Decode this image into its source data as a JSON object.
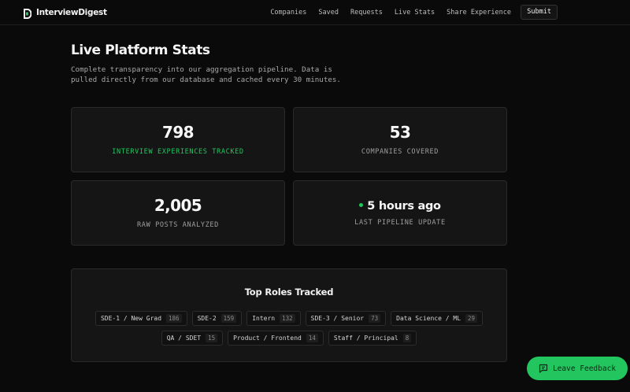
{
  "brand": {
    "name": "InterviewDigest",
    "accent": "#22c55e"
  },
  "nav": {
    "links": [
      "Companies",
      "Saved",
      "Requests",
      "Live Stats",
      "Share Experience"
    ],
    "submit_label": "Submit"
  },
  "page": {
    "title": "Live Platform Stats",
    "description": "Complete transparency into our aggregation pipeline. Data is pulled directly from our database and cached every 30 minutes."
  },
  "stats": [
    {
      "value": "798",
      "label": "INTERVIEW EXPERIENCES TRACKED",
      "highlight": true
    },
    {
      "value": "53",
      "label": "COMPANIES COVERED",
      "highlight": false
    },
    {
      "value": "2,005",
      "label": "RAW POSTS ANALYZED",
      "highlight": false
    },
    {
      "value": "5 hours ago",
      "label": "LAST PIPELINE UPDATE",
      "highlight": false,
      "status_dot": true
    }
  ],
  "roles": {
    "title": "Top Roles Tracked",
    "items": [
      {
        "name": "SDE-1 / New Grad",
        "count": "186"
      },
      {
        "name": "SDE-2",
        "count": "159"
      },
      {
        "name": "Intern",
        "count": "132"
      },
      {
        "name": "SDE-3 / Senior",
        "count": "73"
      },
      {
        "name": "Data Science / ML",
        "count": "29"
      },
      {
        "name": "QA / SDET",
        "count": "15"
      },
      {
        "name": "Product / Frontend",
        "count": "14"
      },
      {
        "name": "Staff / Principal",
        "count": "8"
      }
    ]
  },
  "feedback": {
    "label": "Leave Feedback",
    "icon": "message-icon"
  }
}
